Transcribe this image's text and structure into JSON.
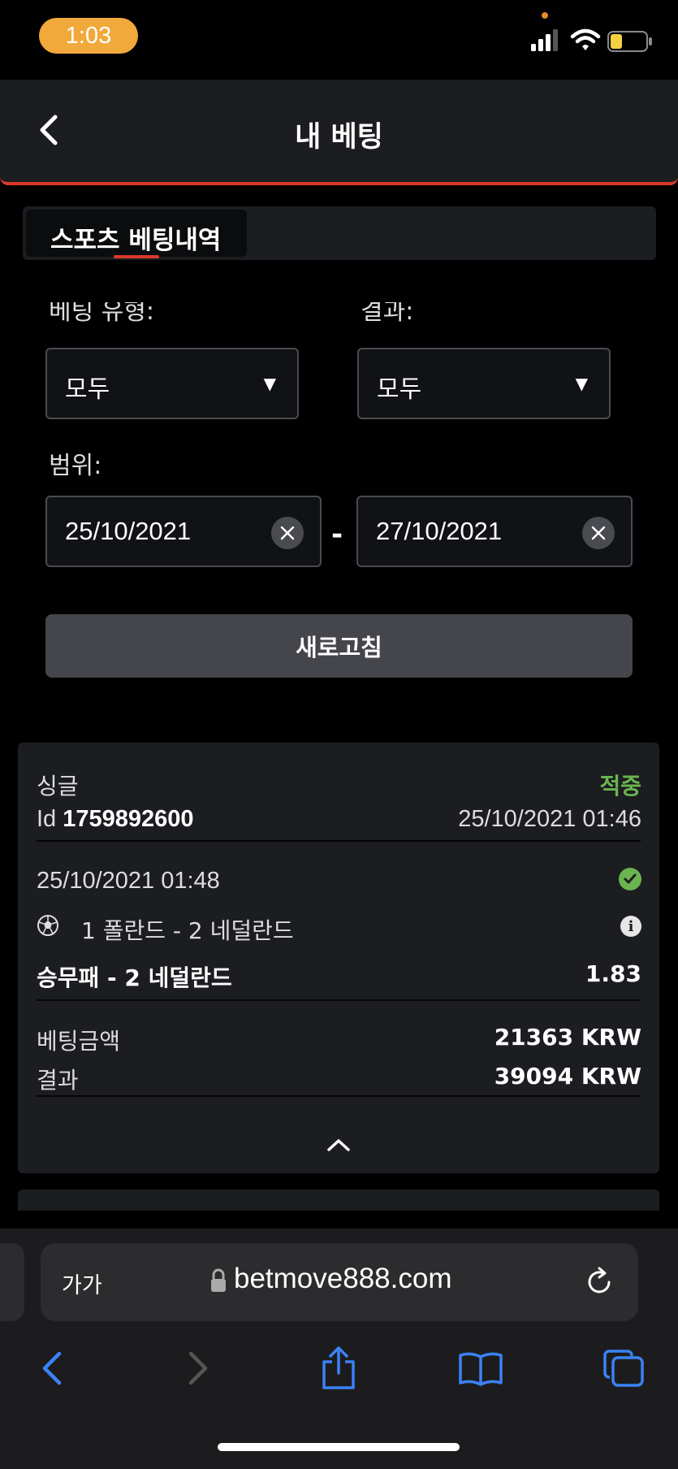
{
  "status_bar": {
    "time": "1:03"
  },
  "header": {
    "title": "내 베팅"
  },
  "tabs": [
    {
      "label": "스포츠 베팅내역"
    }
  ],
  "filters": {
    "bet_type_label": "베팅 유형:",
    "result_label": "결과:",
    "bet_type_value": "모두",
    "result_value": "모두",
    "range_label": "범위:",
    "date_from": "25/10/2021",
    "date_separator": "-",
    "date_to": "27/10/2021",
    "refresh_label": "새로고침"
  },
  "bet": {
    "type": "싱글",
    "status": "적중",
    "id_prefix": "Id",
    "id": "1759892600",
    "placed_at": "25/10/2021 01:46",
    "event_date": "25/10/2021 01:48",
    "match": "1 폴란드 - 2 네덜란드",
    "selection": "승무패 - 2 네덜란드",
    "odds": "1.83",
    "stake_label": "베팅금액",
    "stake_value": "21363 KRW",
    "result_label": "결과",
    "result_value": "39094 KRW"
  },
  "browser": {
    "text_size_label": "가가",
    "url": "betmove888.com"
  },
  "colors": {
    "accent_red": "#d8392b",
    "win_green": "#6bb450",
    "time_pill": "#f2a93b",
    "safari_blue": "#3b82f6"
  }
}
